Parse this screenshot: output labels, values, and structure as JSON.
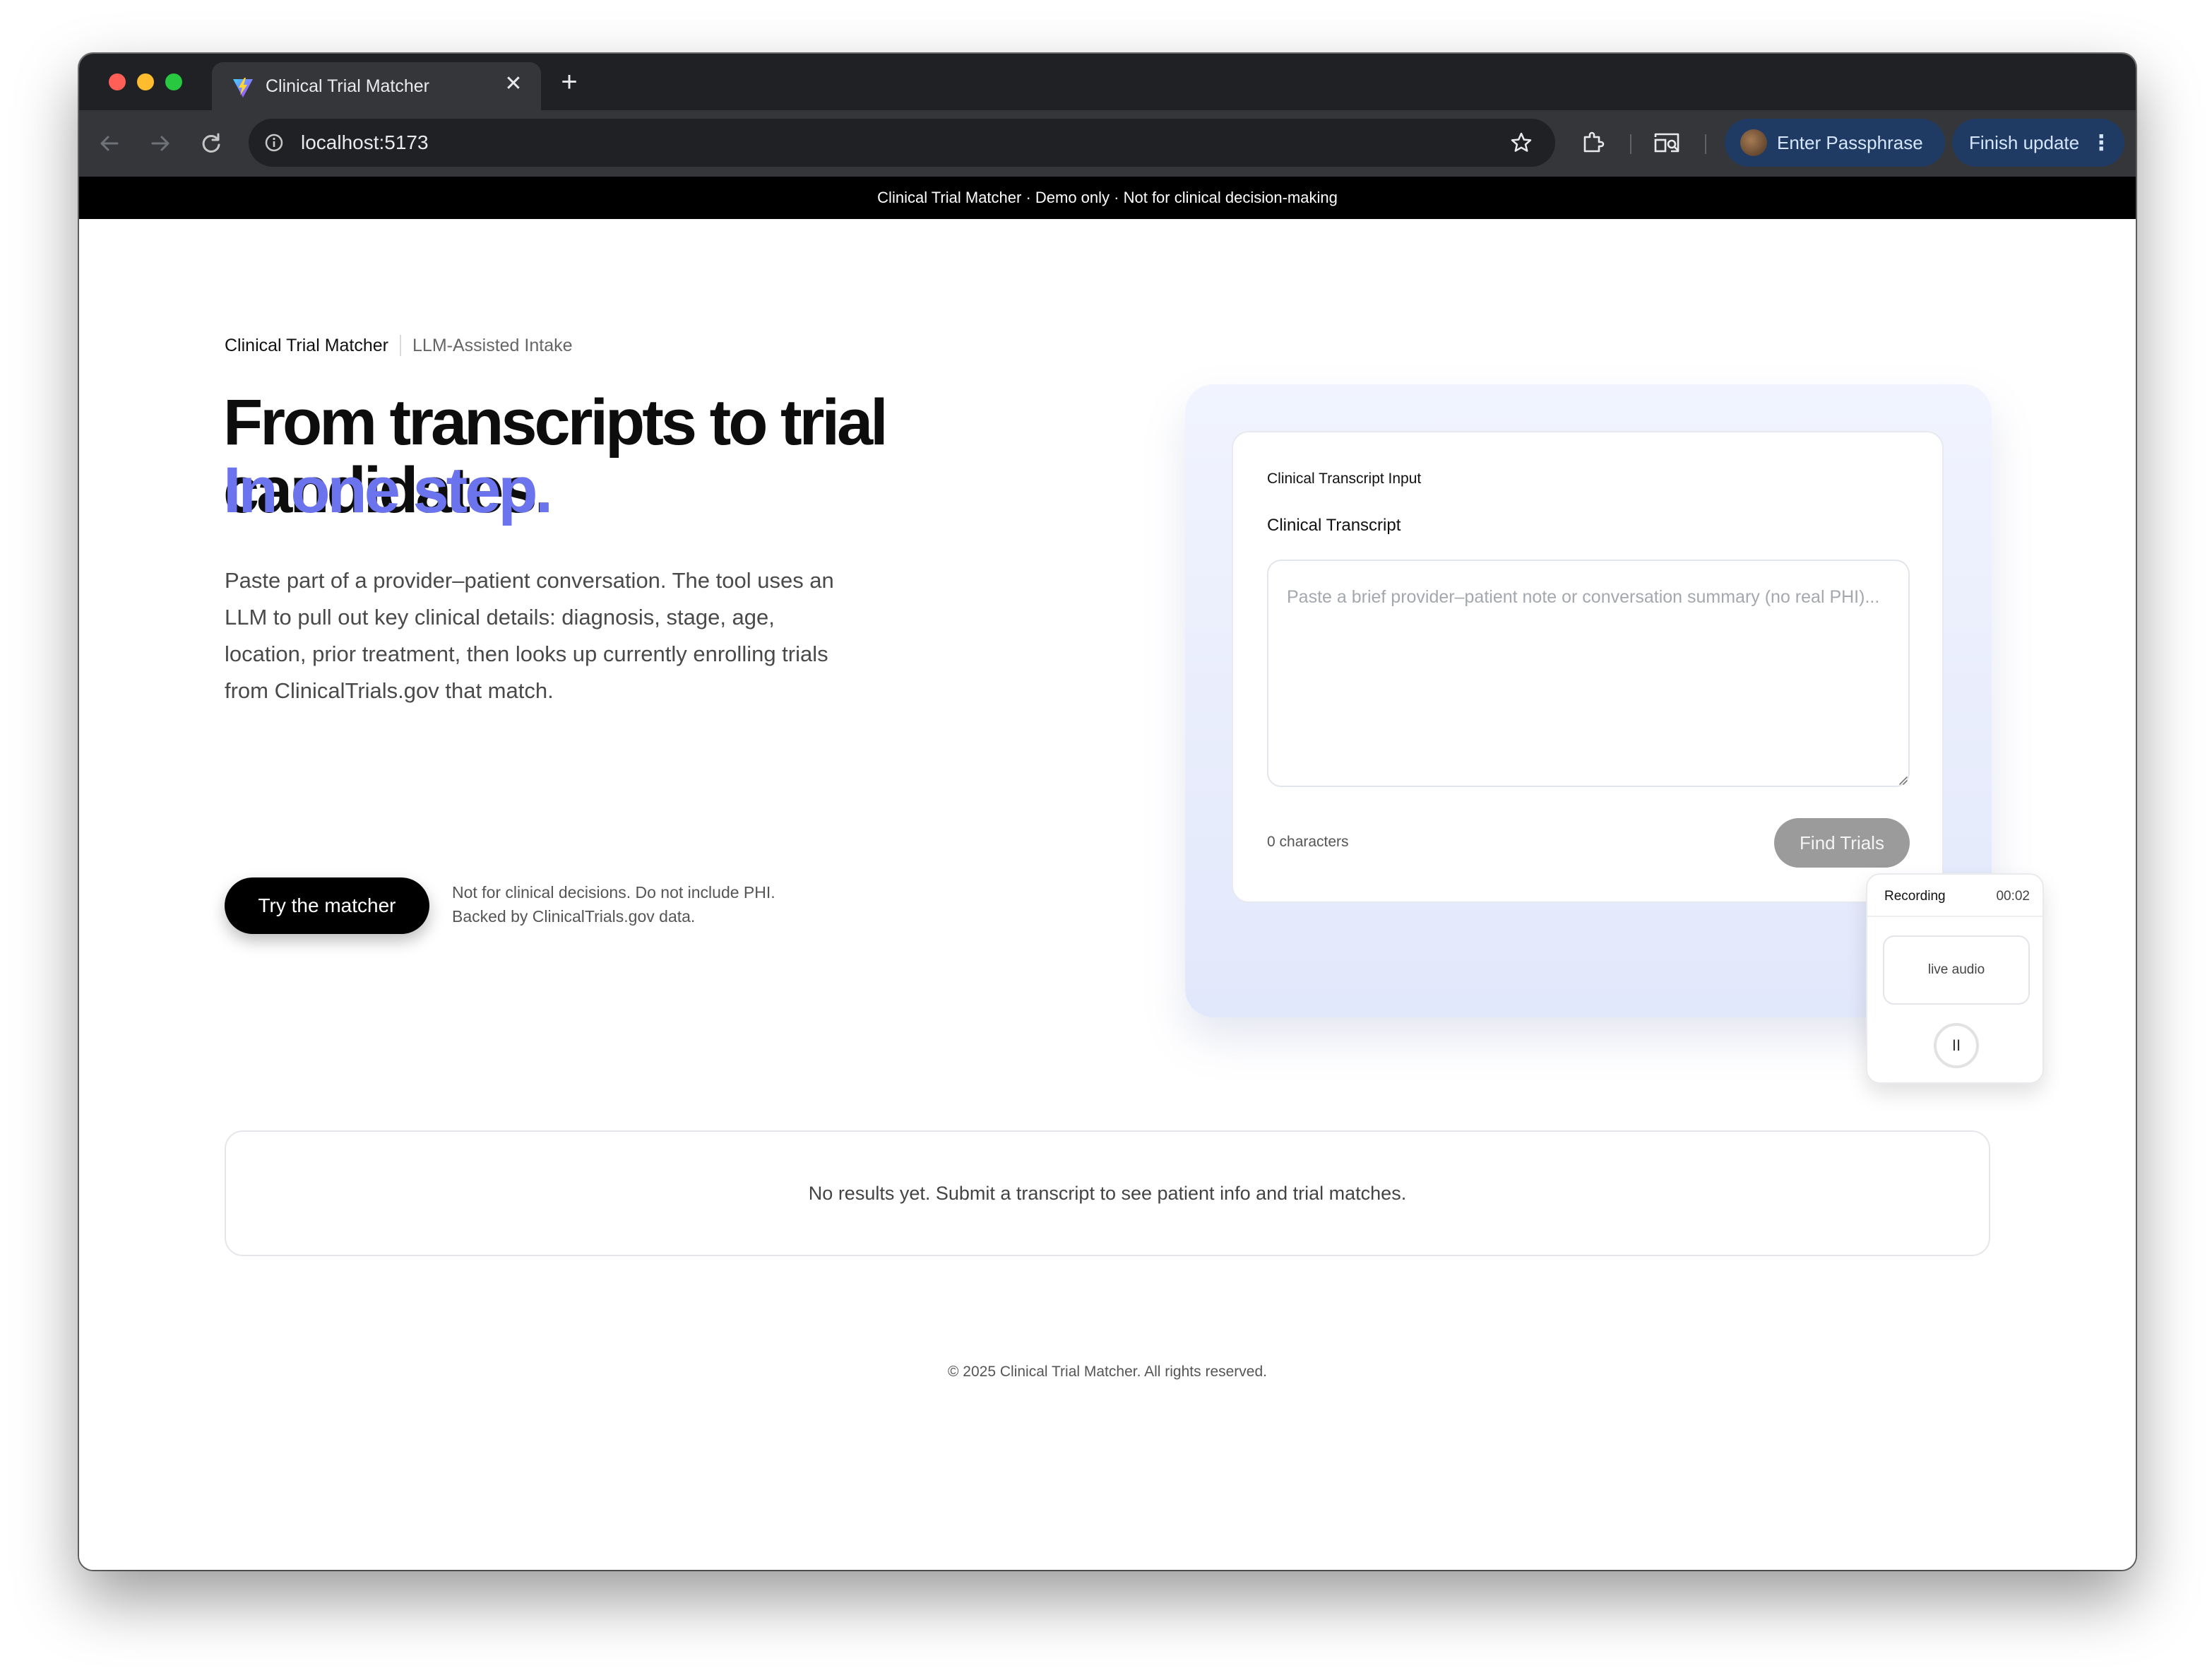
{
  "browser": {
    "tab_title": "Clinical Trial Matcher",
    "tab_close_glyph": "✕",
    "new_tab_glyph": "+",
    "url": "localhost:5173",
    "profile_label": "Enter Passphrase",
    "update_label": "Finish update",
    "icons": [
      "back-arrow-icon",
      "forward-arrow-icon",
      "reload-icon",
      "info-icon",
      "star-icon",
      "extensions-icon",
      "cast-search-icon",
      "menu-dots-icon"
    ]
  },
  "banner": {
    "text": "Clinical Trial Matcher · Demo only · Not for clinical decision-making"
  },
  "hero": {
    "brand": "Clinical Trial Matcher",
    "brand_sub": "LLM-Assisted Intake",
    "headline": "From transcripts to trial candidates.",
    "headline_accent": "In one step.",
    "lede": "Paste part of a provider–patient conversation. The tool uses an LLM to pull out key clinical details: diagnosis, stage, age, location, prior treatment, then looks up currently enrolling trials from ClinicalTrials.gov that match.",
    "cta_label": "Try the matcher",
    "cta_note_line1": "Not for clinical decisions. Do not include PHI.",
    "cta_note_line2": "Backed by ClinicalTrials.gov data."
  },
  "form": {
    "card_title": "Clinical Transcript Input",
    "field_label": "Clinical Transcript",
    "placeholder": "Paste a brief provider–patient note or conversation summary (no real PHI)...",
    "value": "",
    "char_count": "0 characters",
    "submit_label": "Find Trials"
  },
  "recorder": {
    "title": "Recording",
    "elapsed": "00:02",
    "live_label": "live audio",
    "pause_glyph": "II"
  },
  "results": {
    "empty_text": "No results yet. Submit a transcript to see patient info and trial matches."
  },
  "footer": {
    "text": "© 2025 Clinical Trial Matcher. All rights reserved."
  },
  "colors": {
    "accent": "#6b74ec",
    "chrome_dark": "#202124",
    "chrome_tab": "#35363a",
    "profile_pill": "#1f3b63",
    "button_disabled": "#9b9b9b"
  }
}
